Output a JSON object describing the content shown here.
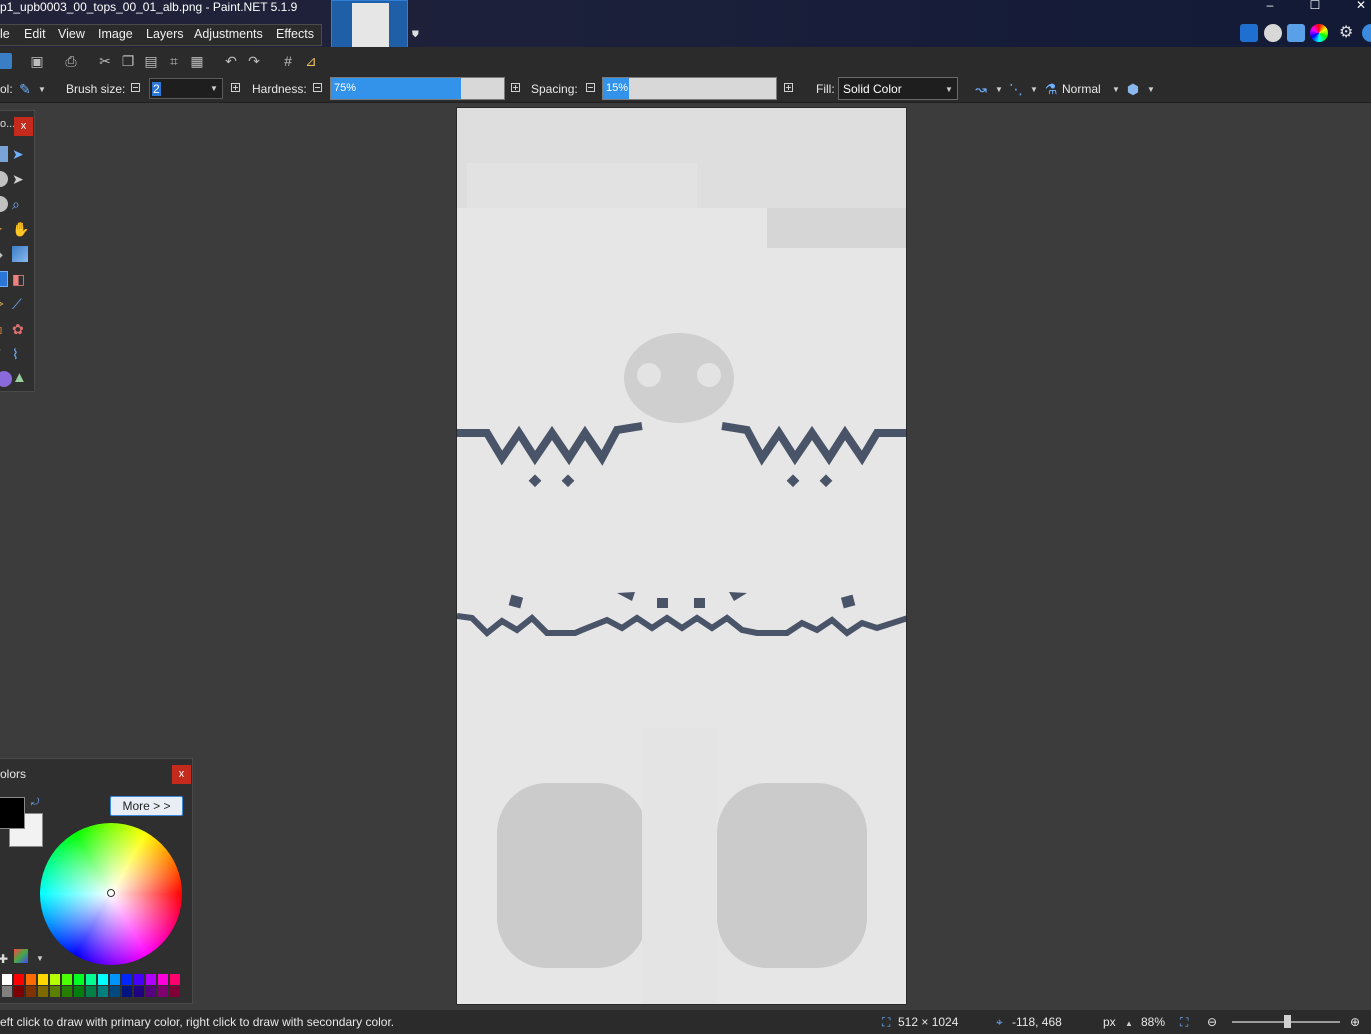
{
  "window": {
    "title": "p1_upb0003_00_tops_00_01_alb.png - Paint.NET 5.1.9",
    "minimize": "–",
    "maximize": "☐",
    "close": "✕"
  },
  "menu": {
    "file": "le",
    "edit": "Edit",
    "view": "View",
    "image": "Image",
    "layers": "Layers",
    "adjustments": "Adjustments",
    "effects": "Effects"
  },
  "options": {
    "tool_label": "ol:",
    "brush_size_label": "Brush size:",
    "brush_size_value": "2",
    "hardness_label": "Hardness:",
    "hardness_value": "75%",
    "hardness_fraction": 0.75,
    "spacing_label": "Spacing:",
    "spacing_value": "15%",
    "spacing_fraction": 0.15,
    "fill_label": "Fill:",
    "fill_value": "Solid Color",
    "blend_mode": "Normal"
  },
  "tools_panel": {
    "title": "o...",
    "close": "x"
  },
  "colors_panel": {
    "title": "olors",
    "close": "x",
    "more_button": "More > >",
    "primary_color": "#000000",
    "secondary_color": "#f2f2f2",
    "palette_top": [
      "#ffffff",
      "#ff0000",
      "#ff6a00",
      "#ffd800",
      "#b6ff00",
      "#4cff00",
      "#00ff21",
      "#00ff90",
      "#00ffff",
      "#0094ff",
      "#0026ff",
      "#4800ff",
      "#b200ff",
      "#ff00dc",
      "#ff006e"
    ],
    "palette_bottom": [
      "#808080",
      "#7f0000",
      "#7f3300",
      "#7f6a00",
      "#5b7f00",
      "#267f00",
      "#007f0e",
      "#007f46",
      "#007f7f",
      "#004a7f",
      "#00137f",
      "#21007f",
      "#57007f",
      "#7f006e",
      "#7f0037"
    ]
  },
  "status": {
    "message": "eft click to draw with primary color, right click to draw with secondary color.",
    "image_size": "512 × 1024",
    "cursor_position": "-118, 468",
    "units": "px",
    "zoom": "88%"
  }
}
